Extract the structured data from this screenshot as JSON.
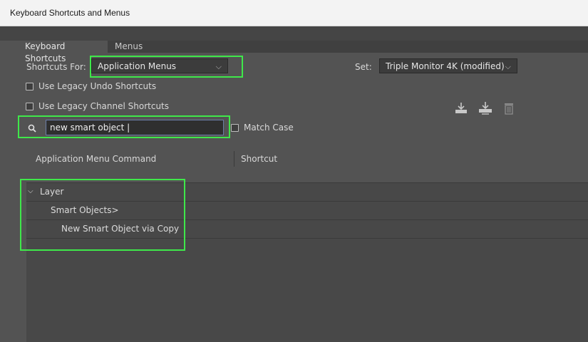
{
  "window": {
    "title": "Keyboard Shortcuts and Menus"
  },
  "tabs": [
    {
      "label": "Keyboard Shortcuts"
    },
    {
      "label": "Menus"
    }
  ],
  "shortcuts_for": {
    "label": "Shortcuts For:",
    "value": "Application Menus"
  },
  "set": {
    "label": "Set:",
    "value": "Triple Monitor 4K (modified)"
  },
  "options": {
    "legacy_undo": "Use Legacy Undo Shortcuts",
    "legacy_channel": "Use Legacy Channel Shortcuts",
    "match_case": "Match Case"
  },
  "search": {
    "value": "new smart object |"
  },
  "table": {
    "columns": [
      "Application Menu Command",
      "Shortcut"
    ],
    "rows": [
      {
        "label": "Layer",
        "expanded": true
      },
      {
        "label": "Smart Objects>"
      },
      {
        "label": "New Smart Object via Copy"
      }
    ]
  },
  "icons": {
    "save_set": "save-set-icon",
    "save_set_as": "save-set-as-icon",
    "delete_set": "trash-icon",
    "search": "search-icon",
    "expand": "chevron-down-icon"
  },
  "colors": {
    "highlight": "#3fe84a",
    "background": "#535353"
  }
}
